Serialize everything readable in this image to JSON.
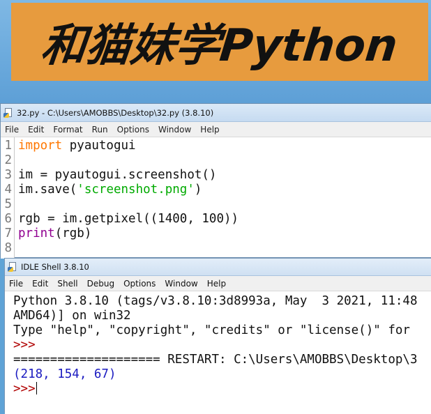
{
  "banner": {
    "text": "和猫妹学Python"
  },
  "editor": {
    "title": "32.py - C:\\Users\\AMOBBS\\Desktop\\32.py (3.8.10)",
    "menu": [
      "File",
      "Edit",
      "Format",
      "Run",
      "Options",
      "Window",
      "Help"
    ],
    "line_numbers": [
      "1",
      "2",
      "3",
      "4",
      "5",
      "6",
      "7",
      "8"
    ],
    "code": {
      "l1_kw": "import",
      "l1_rest": " pyautogui",
      "l3": "im = pyautogui.screenshot()",
      "l4_a": "im.save(",
      "l4_str": "'screenshot.png'",
      "l4_b": ")",
      "l6": "rgb = im.getpixel((1400, 100))",
      "l7_bi": "print",
      "l7_rest": "(rgb)"
    }
  },
  "shell": {
    "title": "IDLE Shell 3.8.10",
    "menu": [
      "File",
      "Edit",
      "Shell",
      "Debug",
      "Options",
      "Window",
      "Help"
    ],
    "lines": {
      "l1": "Python 3.8.10 (tags/v3.8.10:3d8993a, May  3 2021, 11:48",
      "l2": "AMD64)] on win32",
      "l3": "Type \"help\", \"copyright\", \"credits\" or \"license()\" for",
      "prompt": ">>>",
      "restart": "==================== RESTART: C:\\Users\\AMOBBS\\Desktop\\3",
      "output": "(218, 154, 67)"
    }
  }
}
